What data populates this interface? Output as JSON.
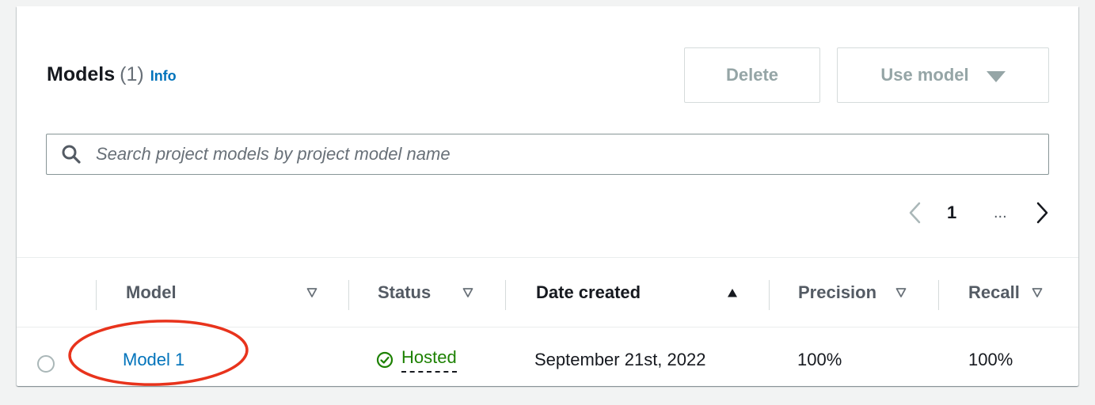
{
  "header": {
    "title": "Models",
    "count": "(1)",
    "info_link": "Info"
  },
  "actions": {
    "delete_label": "Delete",
    "use_model_label": "Use model"
  },
  "search": {
    "placeholder": "Search project models by project model name",
    "value": ""
  },
  "pagination": {
    "current_page": "1",
    "ellipsis": "..."
  },
  "table": {
    "columns": [
      {
        "label": "Model"
      },
      {
        "label": "Status"
      },
      {
        "label": "Date created",
        "sort": "ascending"
      },
      {
        "label": "Precision"
      },
      {
        "label": "Recall"
      }
    ],
    "rows": [
      {
        "model": "Model 1",
        "status": "Hosted",
        "date_created": "September 21st, 2022",
        "precision": "100%",
        "recall": "100%",
        "selected": false
      }
    ]
  },
  "colors": {
    "link": "#0073bb",
    "status_ok": "#1d8102",
    "annotation": "#e8331c",
    "disabled_text": "#95a5a6"
  }
}
